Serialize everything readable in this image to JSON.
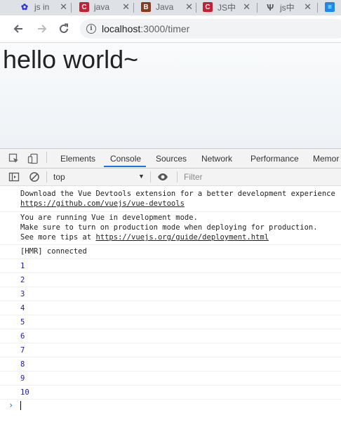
{
  "tabs": [
    {
      "title": "js in",
      "icon": "baidu-paw-icon",
      "color": "#2932e1"
    },
    {
      "title": "java",
      "icon": "csdn-c-icon",
      "color": "#c32136"
    },
    {
      "title": "Java",
      "icon": "b-logo-icon",
      "color": "#8b3a1f"
    },
    {
      "title": "JS中",
      "icon": "csdn-c-icon",
      "color": "#c32136"
    },
    {
      "title": "js中",
      "icon": "zhihu-logo-icon",
      "color": "#555555"
    },
    {
      "title": "",
      "icon": "book-icon",
      "color": "#1e88e5"
    }
  ],
  "address": {
    "host": "localhost",
    "path": ":3000/timer"
  },
  "page": {
    "heading": "hello world~"
  },
  "devtools": {
    "tabs": [
      "Elements",
      "Console",
      "Sources",
      "Network",
      "Performance",
      "Memor"
    ],
    "active_tab": "Console",
    "context": "top",
    "filter_placeholder": "Filter"
  },
  "console": {
    "devtools_msg_line1": "Download the Vue Devtools extension for a better development experience",
    "devtools_msg_link": "https://github.com/vuejs/vue-devtools",
    "dev_mode_line1": "You are running Vue in development mode.",
    "dev_mode_line2": "Make sure to turn on production mode when deploying for production.",
    "dev_mode_line3_prefix": "See more tips at ",
    "dev_mode_link": "https://vuejs.org/guide/deployment.html",
    "hmr": "[HMR] connected",
    "numbers": [
      "1",
      "2",
      "3",
      "4",
      "5",
      "6",
      "7",
      "8",
      "9",
      "10"
    ],
    "prompt": "›"
  },
  "colors": {
    "accent": "#1a73e8",
    "number": "#1a1aa6"
  }
}
